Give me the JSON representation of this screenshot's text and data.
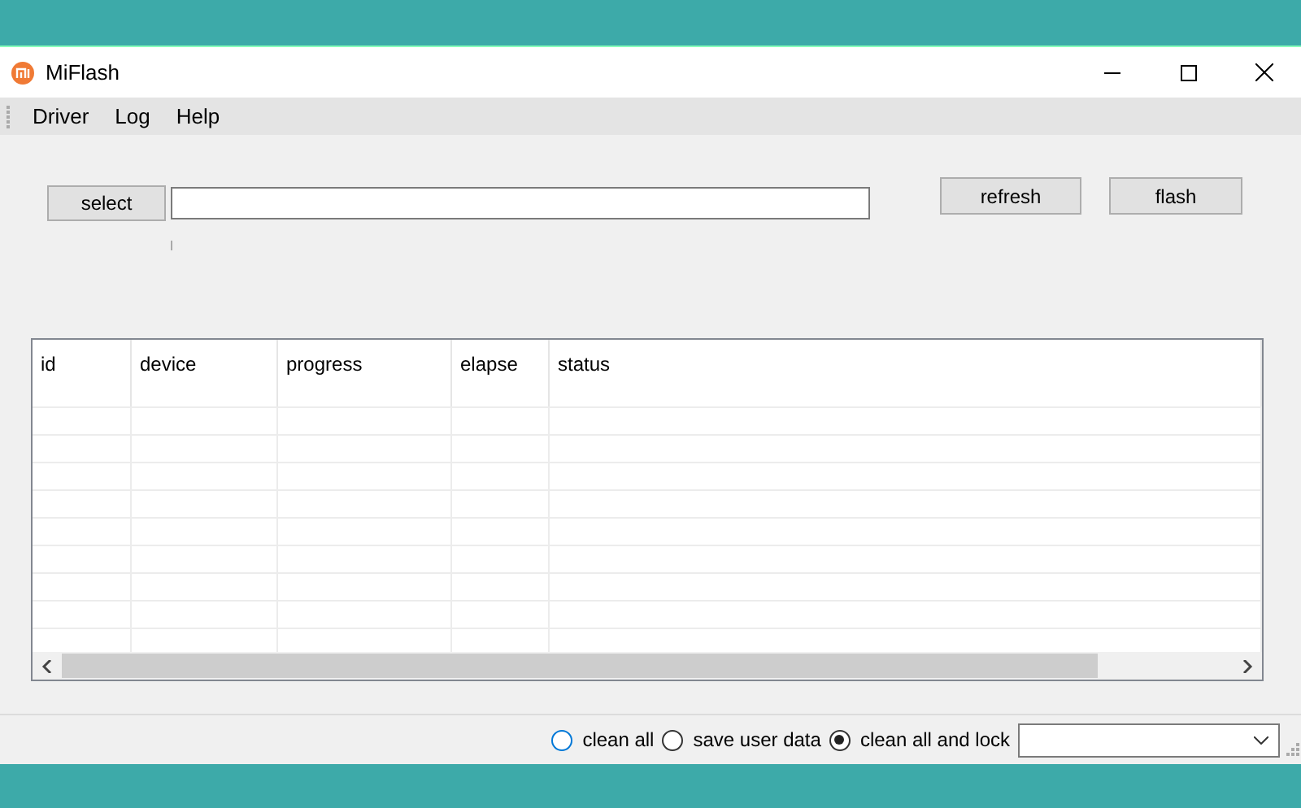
{
  "window": {
    "title": "MiFlash"
  },
  "menu": [
    "Driver",
    "Log",
    "Help"
  ],
  "toolbar": {
    "select_button": "select",
    "refresh_button": "refresh",
    "flash_button": "flash"
  },
  "table": {
    "columns": [
      "id",
      "device",
      "progress",
      "elapse",
      "status"
    ]
  },
  "options": [
    {
      "label": "clean all",
      "selected": false
    },
    {
      "label": "save user data",
      "selected": false
    },
    {
      "label": "clean all and lock",
      "selected": true
    }
  ]
}
